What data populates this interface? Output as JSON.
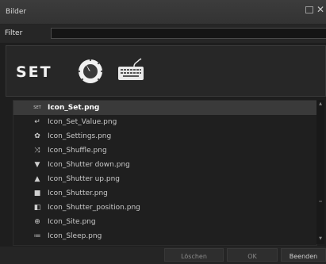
{
  "window": {
    "title": "Bilder"
  },
  "titlebar_icons": {
    "maximize": "maximize-icon",
    "close": "close-icon",
    "close_glyph": "✕"
  },
  "filter": {
    "label": "Filter",
    "value": ""
  },
  "preview": {
    "set_text": "SET",
    "icons": [
      "dial-icon",
      "keyboard-icon"
    ]
  },
  "list": {
    "selected_index": 0,
    "items": [
      {
        "label": "Icon_Set.png",
        "icon": "set-icon",
        "glyph": "SET"
      },
      {
        "label": "Icon_Set_Value.png",
        "icon": "set-value-icon",
        "glyph": "↵"
      },
      {
        "label": "Icon_Settings.png",
        "icon": "settings-icon",
        "glyph": "✿"
      },
      {
        "label": "Icon_Shuffle.png",
        "icon": "shuffle-icon",
        "glyph": "⤨"
      },
      {
        "label": "Icon_Shutter down.png",
        "icon": "shutter-down-icon",
        "glyph": "▼"
      },
      {
        "label": "Icon_Shutter up.png",
        "icon": "shutter-up-icon",
        "glyph": "▲"
      },
      {
        "label": "Icon_Shutter.png",
        "icon": "shutter-icon",
        "glyph": "■"
      },
      {
        "label": "Icon_Shutter_position.png",
        "icon": "shutter-position-icon",
        "glyph": "◧"
      },
      {
        "label": "Icon_Site.png",
        "icon": "site-icon",
        "glyph": "⊕"
      },
      {
        "label": "Icon_Sleep.png",
        "icon": "sleep-icon",
        "glyph": "≔"
      }
    ]
  },
  "footer": {
    "delete_label": "Löschen",
    "ok_label": "OK",
    "quit_label": "Beenden"
  }
}
